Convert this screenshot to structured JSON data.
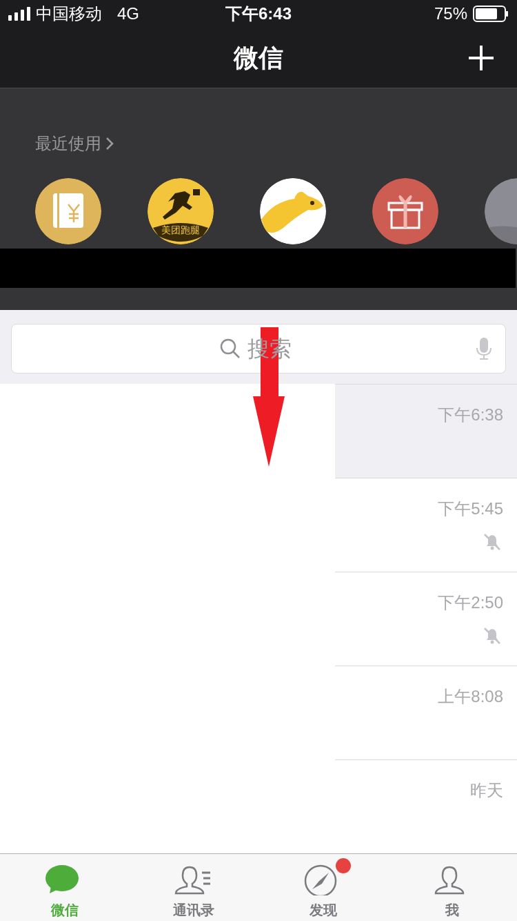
{
  "status_bar": {
    "carrier": "中国移动",
    "network": "4G",
    "time": "下午6:43",
    "battery": "75%"
  },
  "nav": {
    "title": "微信"
  },
  "recent": {
    "heading": "最近使用",
    "apps": [
      {
        "kind": "ledger"
      },
      {
        "kind": "runner",
        "label": "美团跑腿"
      },
      {
        "kind": "kangaroo"
      },
      {
        "kind": "gift"
      },
      {
        "kind": "person"
      }
    ]
  },
  "search": {
    "placeholder": "搜索"
  },
  "chats": [
    {
      "time": "下午6:38",
      "pinned": true,
      "muted": false
    },
    {
      "time": "下午5:45",
      "pinned": false,
      "muted": true
    },
    {
      "time": "下午2:50",
      "pinned": false,
      "muted": true
    },
    {
      "time": "上午8:08",
      "pinned": false,
      "muted": false
    },
    {
      "time": "昨天",
      "pinned": false,
      "muted": false
    }
  ],
  "tabs": [
    {
      "label": "微信",
      "selected": true,
      "kind": "chat",
      "badge": false
    },
    {
      "label": "通讯录",
      "selected": false,
      "kind": "contacts",
      "badge": false
    },
    {
      "label": "发现",
      "selected": false,
      "kind": "discover",
      "badge": true
    },
    {
      "label": "我",
      "selected": false,
      "kind": "me",
      "badge": false
    }
  ]
}
